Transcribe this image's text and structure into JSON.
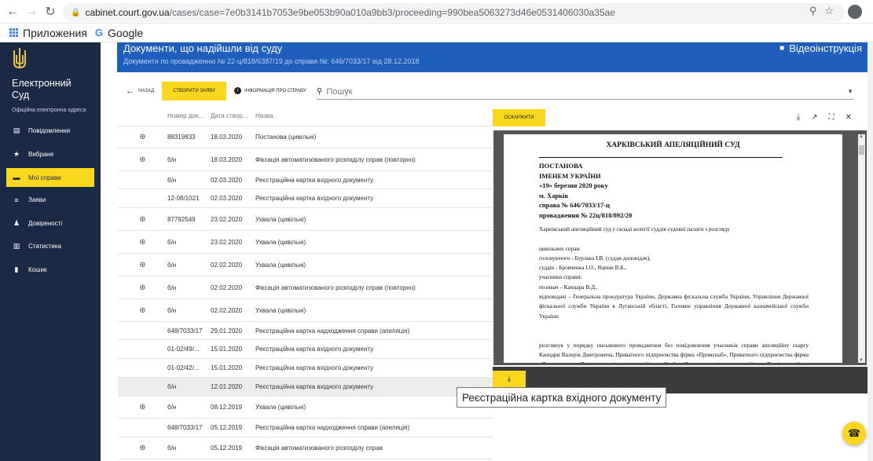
{
  "browser": {
    "url_host": "cabinet.court.gov.ua",
    "url_path": "/cases/case=7e0b3141b7053e9be053b90a010a9bb3/proceeding=990bea5063273d46e0531406030a35ae",
    "bookmarks": [
      {
        "label": "Приложения",
        "icon": "apps-grid-icon"
      },
      {
        "label": "Google",
        "icon": "google-icon"
      }
    ]
  },
  "sidebar": {
    "title": "Електронний Суд",
    "subtitle": "Офіційна електронна адреса",
    "items": [
      {
        "label": "Повідомлення",
        "icon": "message-icon",
        "active": false
      },
      {
        "label": "Вибране",
        "icon": "star-icon",
        "active": false
      },
      {
        "label": "Мої справи",
        "icon": "folder-icon",
        "active": true
      },
      {
        "label": "Заяви",
        "icon": "list-icon",
        "active": false
      },
      {
        "label": "Довіреності",
        "icon": "people-icon",
        "active": false
      },
      {
        "label": "Статистика",
        "icon": "stats-icon",
        "active": false
      },
      {
        "label": "Кошик",
        "icon": "trash-icon",
        "active": false
      }
    ]
  },
  "banner": {
    "title": "Документи, що надійшли від суду",
    "subtitle": "Документи по провадженню № 22-ц/818/6387/19 до справи №: 646/7033/17 від 28.12.2018",
    "video_label": "Відеоінструкція"
  },
  "toolbar": {
    "back_label": "НАЗАД",
    "create_label": "СТВОРИТИ ЗАЯВУ",
    "info_label": "ІНФОРМАЦІЯ ПРО СПРАВУ",
    "search_placeholder": "Пошук"
  },
  "table": {
    "headers": [
      "Номер док...",
      "Дата створ...",
      "Назва"
    ],
    "rows": [
      {
        "attach": true,
        "number": "88319833",
        "date": "18.03.2020",
        "name": "Постанова (цивільні)",
        "h": 28
      },
      {
        "attach": true,
        "number": "б/н",
        "date": "18.03.2020",
        "name": "Фіксація автоматизованого розподілу справ (повторно)",
        "h": 29
      },
      {
        "attach": false,
        "number": "б/н",
        "date": "02.03.2020",
        "name": "Реєстраційна картка вхідного документу",
        "h": 23
      },
      {
        "attach": false,
        "number": "12-08/1021",
        "date": "02.03.2020",
        "name": "Реєстраційна картка вхідного документу",
        "h": 24
      },
      {
        "attach": true,
        "number": "87792549",
        "date": "23.02.2020",
        "name": "Ухвала (цивільні)",
        "h": 29
      },
      {
        "attach": true,
        "number": "б/н",
        "date": "23.02.2020",
        "name": "Ухвала (цивільні)",
        "h": 29
      },
      {
        "attach": true,
        "number": "б/н",
        "date": "02.02.2020",
        "name": "Ухвала (цивільні)",
        "h": 29
      },
      {
        "attach": true,
        "number": "б/н",
        "date": "02.02.2020",
        "name": "Фіксація автоматизованого розподілу справ (повторно)",
        "h": 29
      },
      {
        "attach": true,
        "number": "б/н",
        "date": "02.02.2020",
        "name": "Ухвала (цивільні)",
        "h": 29
      },
      {
        "attach": false,
        "number": "648/7033/17",
        "date": "29.01.2020",
        "name": "Реєстраційна картка надходження справи (апеляція)",
        "h": 23
      },
      {
        "attach": false,
        "number": "01-02/49/...",
        "date": "15.01.2020",
        "name": "Реєстраційна картка вхідного документу",
        "h": 24
      },
      {
        "attach": false,
        "number": "01-02/42/...",
        "date": "15.01.2020",
        "name": "Реєстраційна картка вхідного документу",
        "h": 24
      },
      {
        "attach": false,
        "number": "б/н",
        "date": "12.01.2020",
        "name": "Реєстраційна картка вхідного документу",
        "h": 24,
        "selected": true
      },
      {
        "attach": true,
        "number": "б/н",
        "date": "08.12.2019",
        "name": "Ухвала (цивільні)",
        "h": 28
      },
      {
        "attach": false,
        "number": "648/7033/17",
        "date": "05.12.2019",
        "name": "Реєстраційна картка надходження справи (апеляція)",
        "h": 24
      },
      {
        "attach": true,
        "number": "б/н",
        "date": "05.12.2019",
        "name": "Фіксація автоматизованого розподілу справ",
        "h": 28
      }
    ]
  },
  "viewer": {
    "appeal_label": "ОСКАРЖИТИ",
    "tools": [
      "download-icon",
      "open-external-icon",
      "fullscreen-icon",
      "close-icon"
    ],
    "document": {
      "court": "ХАРКІВСЬКИЙ АПЕЛЯЦІЙНИЙ СУД",
      "head_lines": [
        "ПОСТАНОВА",
        "ІМЕНЕМ  УКРАЇНИ",
        "«19» березня 2020 року",
        "м. Харків",
        "справа № 646/7033/17-ц",
        "провадження № 22ц/818/892/20"
      ],
      "body_paragraphs": [
        "Харківський апеляційний суд у складі колегії суддів судової палати з розгляду",
        "",
        "цивільних справ:",
        "головуючого -        Бурлака І.В. (суддя-доповідач),",
        "суддів -         Бровченка І.О., Яцини В.Б.,",
        "учасники справи:",
        "позивач – Канцара В.Д.,",
        "відповідачі – Генеральна прокуратура України, Державна фіскальна служба України, Управління Державної фіскальної служби України в Луганській області, Головне управління Державної казначейської служби України",
        "",
        "",
        "розглянув у порядку письмового провадження без повідомлення учасників справи апеляційну скаргу Канцари Валерія Дмитровича, Приватного підприємства фірма «Промснаб», Приватного підприємства фірма «Промресурси», Приватного підприємства фірма «Длайк», Приватного підприємства фірма «Торгівельний"
      ]
    }
  },
  "tooltip": "Реєстраційна картка вхідного документу",
  "colors": {
    "sidebar_bg": "#1b2a44",
    "banner_bg": "#1e5ebd",
    "accent_yellow": "#f9d71c"
  }
}
